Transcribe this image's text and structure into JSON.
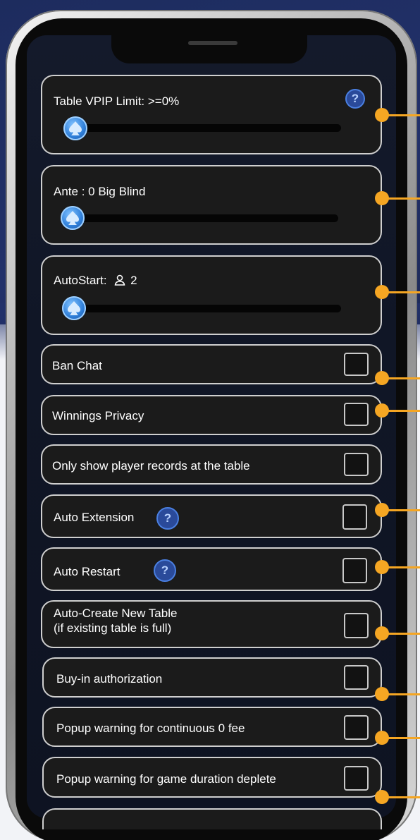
{
  "sliders": [
    {
      "label": "Table VPIP Limit: >=0%",
      "help": true,
      "value": 0
    },
    {
      "label": "Ante : 0 Big Blind",
      "help": false,
      "value": 0
    },
    {
      "label_prefix": "AutoStart:",
      "label_value": "2",
      "icon": "user-icon",
      "value": 0
    }
  ],
  "toggles": [
    {
      "label": "Ban Chat",
      "checked": false
    },
    {
      "label": "Winnings Privacy",
      "checked": false
    },
    {
      "label": "Only show player records at the table",
      "checked": false
    },
    {
      "label": "Auto Extension",
      "help": true,
      "checked": false
    },
    {
      "label": "Auto Restart",
      "help": true,
      "checked": false
    },
    {
      "label_line1": "Auto-Create New Table",
      "label_line2": "(if existing table is full)",
      "checked": false
    },
    {
      "label": "Buy-in authorization",
      "checked": false
    },
    {
      "label": "Popup warning for continuous 0 fee",
      "checked": false
    },
    {
      "label": "Popup warning for game duration deplete",
      "checked": false
    }
  ],
  "help_glyph": "?",
  "colors": {
    "callout": "#f5a623",
    "thumb": "#2f7fd9",
    "help": "#2a4a9a",
    "card_bg": "#1b1b1b",
    "background_top": "#22316a"
  }
}
